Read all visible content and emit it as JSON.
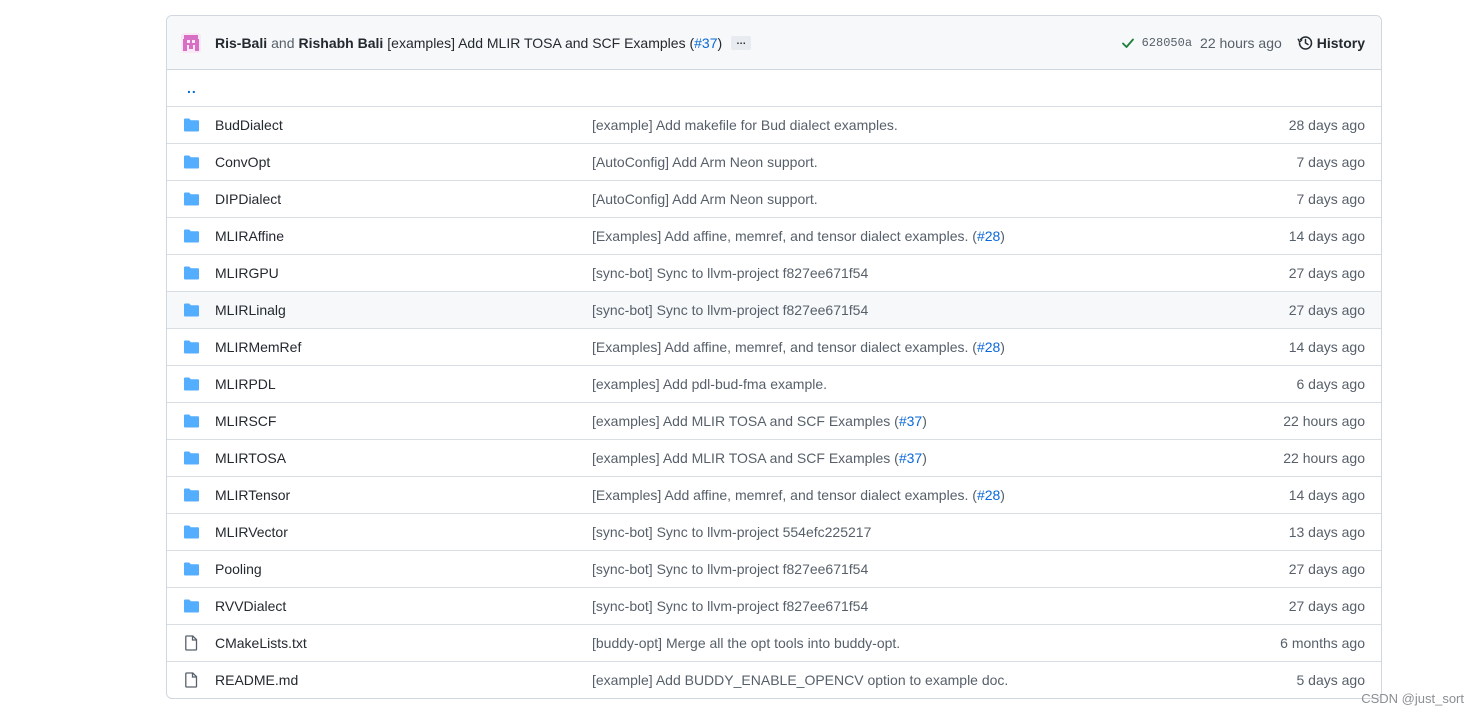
{
  "commit": {
    "author1": "Ris-Bali",
    "and": "and",
    "author2": "Rishabh Bali",
    "message_prefix": "[examples] Add MLIR TOSA and SCF Examples (",
    "message_link": "#37",
    "message_suffix": ")",
    "ellipsis": "…",
    "sha": "628050a",
    "time": "22 hours ago",
    "history_label": "History"
  },
  "parent_dir": "..",
  "rows": [
    {
      "name": "BudDialect",
      "type": "folder",
      "msg": "[example] Add makefile for Bud dialect examples.",
      "link": "",
      "suffix": "",
      "age": "28 days ago"
    },
    {
      "name": "ConvOpt",
      "type": "folder",
      "msg": "[AutoConfig] Add Arm Neon support.",
      "link": "",
      "suffix": "",
      "age": "7 days ago"
    },
    {
      "name": "DIPDialect",
      "type": "folder",
      "msg": "[AutoConfig] Add Arm Neon support.",
      "link": "",
      "suffix": "",
      "age": "7 days ago"
    },
    {
      "name": "MLIRAffine",
      "type": "folder",
      "msg": "[Examples] Add affine, memref, and tensor dialect examples. (",
      "link": "#28",
      "suffix": ")",
      "age": "14 days ago"
    },
    {
      "name": "MLIRGPU",
      "type": "folder",
      "msg": "[sync-bot] Sync to llvm-project f827ee671f54",
      "link": "",
      "suffix": "",
      "age": "27 days ago"
    },
    {
      "name": "MLIRLinalg",
      "type": "folder",
      "msg": "[sync-bot] Sync to llvm-project f827ee671f54",
      "link": "",
      "suffix": "",
      "age": "27 days ago"
    },
    {
      "name": "MLIRMemRef",
      "type": "folder",
      "msg": "[Examples] Add affine, memref, and tensor dialect examples. (",
      "link": "#28",
      "suffix": ")",
      "age": "14 days ago"
    },
    {
      "name": "MLIRPDL",
      "type": "folder",
      "msg": "[examples] Add pdl-bud-fma example.",
      "link": "",
      "suffix": "",
      "age": "6 days ago"
    },
    {
      "name": "MLIRSCF",
      "type": "folder",
      "msg": "[examples] Add MLIR TOSA and SCF Examples (",
      "link": "#37",
      "suffix": ")",
      "age": "22 hours ago"
    },
    {
      "name": "MLIRTOSA",
      "type": "folder",
      "msg": "[examples] Add MLIR TOSA and SCF Examples (",
      "link": "#37",
      "suffix": ")",
      "age": "22 hours ago"
    },
    {
      "name": "MLIRTensor",
      "type": "folder",
      "msg": "[Examples] Add affine, memref, and tensor dialect examples. (",
      "link": "#28",
      "suffix": ")",
      "age": "14 days ago"
    },
    {
      "name": "MLIRVector",
      "type": "folder",
      "msg": "[sync-bot] Sync to llvm-project 554efc225217",
      "link": "",
      "suffix": "",
      "age": "13 days ago"
    },
    {
      "name": "Pooling",
      "type": "folder",
      "msg": "[sync-bot] Sync to llvm-project f827ee671f54",
      "link": "",
      "suffix": "",
      "age": "27 days ago"
    },
    {
      "name": "RVVDialect",
      "type": "folder",
      "msg": "[sync-bot] Sync to llvm-project f827ee671f54",
      "link": "",
      "suffix": "",
      "age": "27 days ago"
    },
    {
      "name": "CMakeLists.txt",
      "type": "file",
      "msg": "[buddy-opt] Merge all the opt tools into buddy-opt.",
      "link": "",
      "suffix": "",
      "age": "6 months ago"
    },
    {
      "name": "README.md",
      "type": "file",
      "msg": "[example] Add BUDDY_ENABLE_OPENCV option to example doc.",
      "link": "",
      "suffix": "",
      "age": "5 days ago"
    }
  ],
  "hovered_row": "MLIRLinalg",
  "watermark": "CSDN @just_sort",
  "colors": {
    "link": "#0969da",
    "folder": "#54aeff",
    "file": "#57606a",
    "check": "#1a7f37",
    "avatar": "#d76fc5"
  }
}
